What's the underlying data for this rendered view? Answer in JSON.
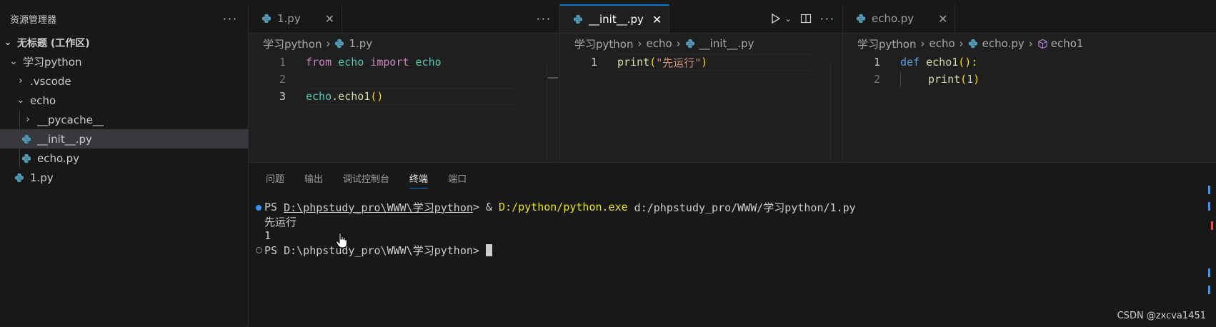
{
  "sidebar": {
    "title": "资源管理器",
    "workspace": "无标题 (工作区)",
    "items": [
      {
        "label": "学习python"
      },
      {
        "label": ".vscode"
      },
      {
        "label": "echo"
      },
      {
        "label": "__pycache__"
      },
      {
        "label": "__init__.py"
      },
      {
        "label": "echo.py"
      },
      {
        "label": "1.py"
      }
    ]
  },
  "editors": [
    {
      "tab": "1.py",
      "breadcrumb": [
        "学习python",
        "1.py"
      ],
      "lines": [
        {
          "num": "1",
          "tokens": [
            "from",
            "echo",
            "import",
            "echo"
          ]
        },
        {
          "num": "2"
        },
        {
          "num": "3",
          "tokens": [
            "echo",
            ".",
            "echo1",
            "()"
          ]
        }
      ]
    },
    {
      "tab": "__init__.py",
      "breadcrumb": [
        "学习python",
        "echo",
        "__init__.py"
      ],
      "lines": [
        {
          "num": "1",
          "tokens": [
            "print",
            "(",
            "\"先运行\"",
            ")"
          ]
        }
      ]
    },
    {
      "tab": "echo.py",
      "breadcrumb": [
        "学习python",
        "echo",
        "echo.py",
        "echo1"
      ],
      "lines": [
        {
          "num": "1",
          "tokens": [
            "def",
            "echo1",
            "():"
          ]
        },
        {
          "num": "2",
          "tokens": [
            "print",
            "(",
            "1",
            ")"
          ]
        }
      ]
    }
  ],
  "panel": {
    "tabs": [
      "问题",
      "输出",
      "调试控制台",
      "终端",
      "端口"
    ],
    "active_tab": "终端"
  },
  "terminal": {
    "prompt_prefix": "PS ",
    "cwd": "D:\\phpstudy_pro\\WWW\\学习python",
    "prompt_suffix": "> ",
    "amp": "& ",
    "exe": "D:/python/python.exe",
    "arg": " d:/phpstudy_pro/WWW/学习python/1.py",
    "output1": "先运行",
    "output2": "1",
    "prompt2": "PS D:\\phpstudy_pro\\WWW\\学习python> "
  },
  "watermark": "CSDN @zxcva1451",
  "colors": {
    "accent": "#0078d4",
    "python_icon": "#519aba"
  }
}
